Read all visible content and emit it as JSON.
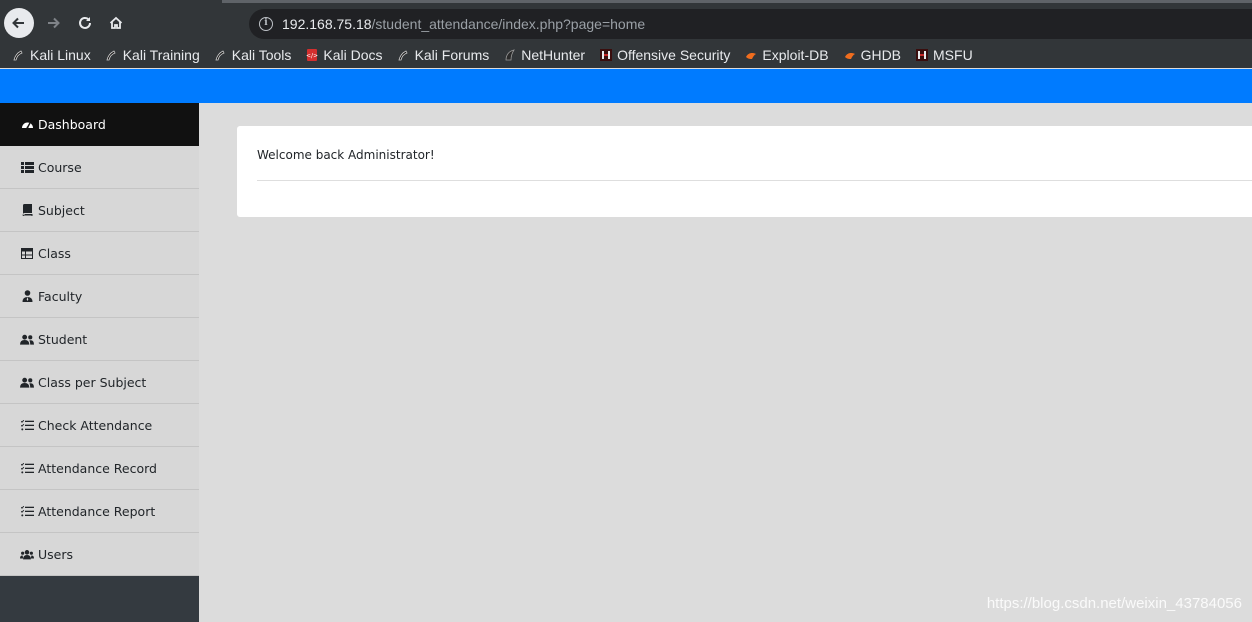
{
  "browser": {
    "url_host": "192.168.75.18",
    "url_path": "/student_attendance/index.php?page=home",
    "bookmarks": [
      {
        "label": "Kali Linux",
        "icon": "kali-dragon-icon"
      },
      {
        "label": "Kali Training",
        "icon": "kali-dragon-icon"
      },
      {
        "label": "Kali Tools",
        "icon": "kali-dragon-icon"
      },
      {
        "label": "Kali Docs",
        "icon": "kali-docs-icon"
      },
      {
        "label": "Kali Forums",
        "icon": "kali-dragon-icon"
      },
      {
        "label": "NetHunter",
        "icon": "nethunter-icon"
      },
      {
        "label": "Offensive Security",
        "icon": "offsec-icon"
      },
      {
        "label": "Exploit-DB",
        "icon": "exploit-db-icon"
      },
      {
        "label": "GHDB",
        "icon": "ghdb-icon"
      },
      {
        "label": "MSFU",
        "icon": "offsec-icon"
      }
    ]
  },
  "sidebar": {
    "items": [
      {
        "label": "Dashboard",
        "icon": "tachometer-icon",
        "active": true
      },
      {
        "label": "Course",
        "icon": "list-icon"
      },
      {
        "label": "Subject",
        "icon": "book-icon"
      },
      {
        "label": "Class",
        "icon": "table-icon"
      },
      {
        "label": "Faculty",
        "icon": "user-tie-icon"
      },
      {
        "label": "Student",
        "icon": "user-friends-icon"
      },
      {
        "label": "Class per Subject",
        "icon": "user-friends-icon"
      },
      {
        "label": "Check Attendance",
        "icon": "tasks-icon"
      },
      {
        "label": "Attendance Record",
        "icon": "tasks-icon"
      },
      {
        "label": "Attendance Report",
        "icon": "tasks-icon"
      },
      {
        "label": "Users",
        "icon": "users-icon"
      }
    ]
  },
  "main": {
    "welcome": "Welcome back Administrator!"
  },
  "watermark": "https://blog.csdn.net/weixin_43784056",
  "colors": {
    "topbar": "#007bff",
    "sidebar_active": "#111111",
    "sidebar_bg": "#343a40"
  }
}
